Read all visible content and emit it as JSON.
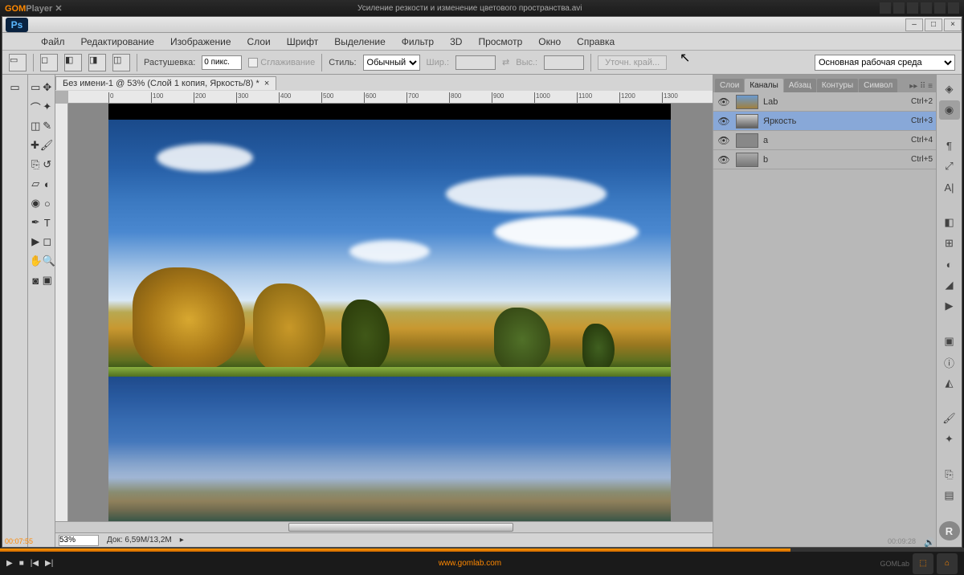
{
  "gom": {
    "logo_bold": "GOM",
    "logo_rest": "Player",
    "video_title": "Усиление резкости и изменение цветового пространства.avi",
    "time_left": "00:07:55",
    "time_right": "00:09:28",
    "url": "www.gomlab.com",
    "footer_label": "GOMLab"
  },
  "ps": {
    "menu": [
      "Файл",
      "Редактирование",
      "Изображение",
      "Слои",
      "Шрифт",
      "Выделение",
      "Фильтр",
      "3D",
      "Просмотр",
      "Окно",
      "Справка"
    ],
    "options": {
      "feather_label": "Растушевка:",
      "feather_value": "0 пикс.",
      "antialias": "Сглаживание",
      "style_label": "Стиль:",
      "style_value": "Обычный",
      "width_label": "Шир.:",
      "height_label": "Выс.:",
      "refine": "Уточн. край...",
      "workspace": "Основная рабочая среда"
    },
    "doc_tab": "Без имени-1 @ 53% (Слой 1 копия, Яркость/8) *",
    "zoom": "53%",
    "doc_info": "Док: 6,59M/13,2M",
    "ruler_marks": [
      "0",
      "100",
      "200",
      "300",
      "400",
      "500",
      "600",
      "700",
      "800",
      "900",
      "1000",
      "1100",
      "1200",
      "1300"
    ],
    "panel_tabs": [
      "Слои",
      "Каналы",
      "Абзац",
      "Контуры",
      "Символ"
    ],
    "active_tab": 1,
    "channels": [
      {
        "name": "Lab",
        "shortcut": "Ctrl+2",
        "selected": false,
        "thumb": "linear-gradient(#6a9ad0,#a08040)"
      },
      {
        "name": "Яркость",
        "shortcut": "Ctrl+3",
        "selected": true,
        "thumb": "linear-gradient(#d0d0d0,#606060)"
      },
      {
        "name": "a",
        "shortcut": "Ctrl+4",
        "selected": false,
        "thumb": "#888"
      },
      {
        "name": "b",
        "shortcut": "Ctrl+5",
        "selected": false,
        "thumb": "linear-gradient(#aaa,#777)"
      }
    ]
  }
}
